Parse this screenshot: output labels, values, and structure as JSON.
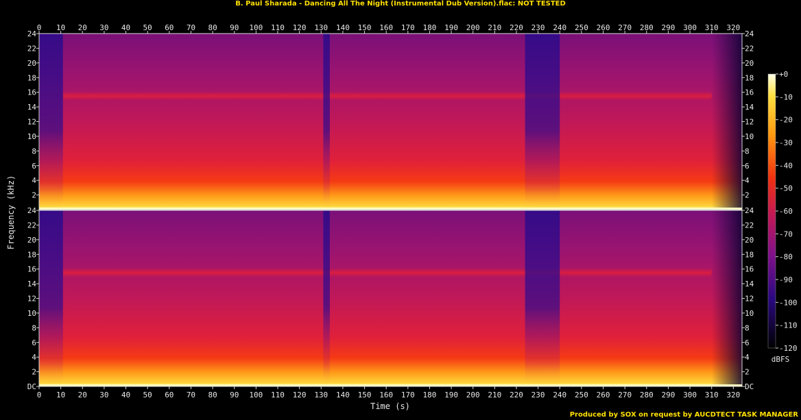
{
  "title": "B. Paul Sharada - Dancing All The Night (Instrumental Dub Version).flac: NOT TESTED",
  "footer": "Produced by SOX on request by AUCDTECT TASK MANAGER",
  "chart_data": {
    "type": "heatmap",
    "title": "B. Paul Sharada - Dancing All The Night (Instrumental Dub Version).flac: NOT TESTED",
    "xlabel": "Time (s)",
    "ylabel": "Frequency (kHz)",
    "xlim": [
      0,
      324
    ],
    "x_ticks": [
      0,
      10,
      20,
      30,
      40,
      50,
      60,
      70,
      80,
      90,
      100,
      110,
      120,
      130,
      140,
      150,
      160,
      170,
      180,
      190,
      200,
      210,
      220,
      230,
      240,
      250,
      260,
      270,
      280,
      290,
      300,
      310,
      320
    ],
    "channels": [
      {
        "ylim": [
          0,
          24
        ],
        "y_ticks": [
          "24",
          "22",
          "20",
          "18",
          "16",
          "14",
          "12",
          "10",
          "8",
          "6",
          "4",
          "2"
        ]
      },
      {
        "ylim": [
          0,
          24
        ],
        "y_ticks": [
          "24",
          "22",
          "20",
          "18",
          "16",
          "14",
          "12",
          "10",
          "8",
          "6",
          "4",
          "2",
          "DC"
        ]
      }
    ],
    "colorbar": {
      "label": "dBFS",
      "range": [
        -120,
        0
      ],
      "ticks": [
        "+0",
        "-10",
        "-20",
        "-30",
        "-40",
        "-50",
        "-60",
        "-70",
        "-80",
        "-90",
        "-100",
        "-110",
        "-120"
      ]
    },
    "energy_band_khz": 15.5,
    "quiet_segments_s": [
      [
        0,
        11
      ],
      [
        131,
        134
      ],
      [
        224,
        240
      ],
      [
        310,
        324
      ]
    ],
    "colors": {
      "title": "#ffe000",
      "axis": "#d8d8d8",
      "background": "#000000"
    }
  }
}
